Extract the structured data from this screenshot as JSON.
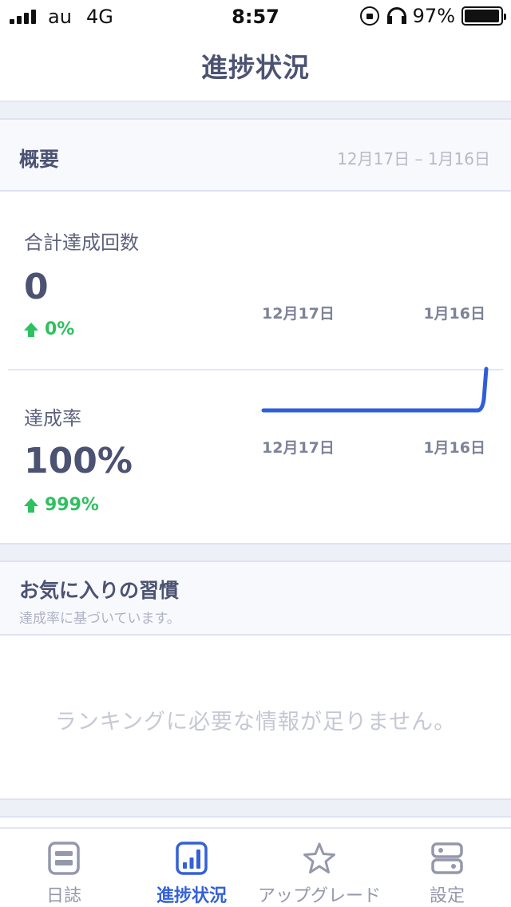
{
  "status_bar": {
    "carrier": "au",
    "network": "4G",
    "time": "8:57",
    "battery": "97%",
    "battery_level": 0.97
  },
  "nav": {
    "title": "進捗状況"
  },
  "overview": {
    "title": "概要",
    "range": "12月17日 – 1月16日",
    "total": {
      "label": "合計達成回数",
      "value": "0",
      "change": "0%",
      "axis_start": "12月17日",
      "axis_end": "1月16日"
    },
    "rate": {
      "label": "達成率",
      "value": "100%",
      "change": "999%",
      "axis_start": "12月17日",
      "axis_end": "1月16日",
      "line_color": "#2f5fd8"
    }
  },
  "favorites": {
    "title": "お気に入りの習慣",
    "subtitle": "達成率に基づいています。",
    "empty_message": "ランキングに必要な情報が足りません。"
  },
  "tabs": [
    {
      "label": "日誌",
      "icon": "journal-icon",
      "active": false
    },
    {
      "label": "進捗状況",
      "icon": "bar-chart-icon",
      "active": true
    },
    {
      "label": "アップグレード",
      "icon": "star-icon",
      "active": false
    },
    {
      "label": "設定",
      "icon": "settings-icon",
      "active": false
    }
  ],
  "colors": {
    "accent": "#3461d8",
    "positive": "#2fc060",
    "inactive": "#9498ab"
  }
}
